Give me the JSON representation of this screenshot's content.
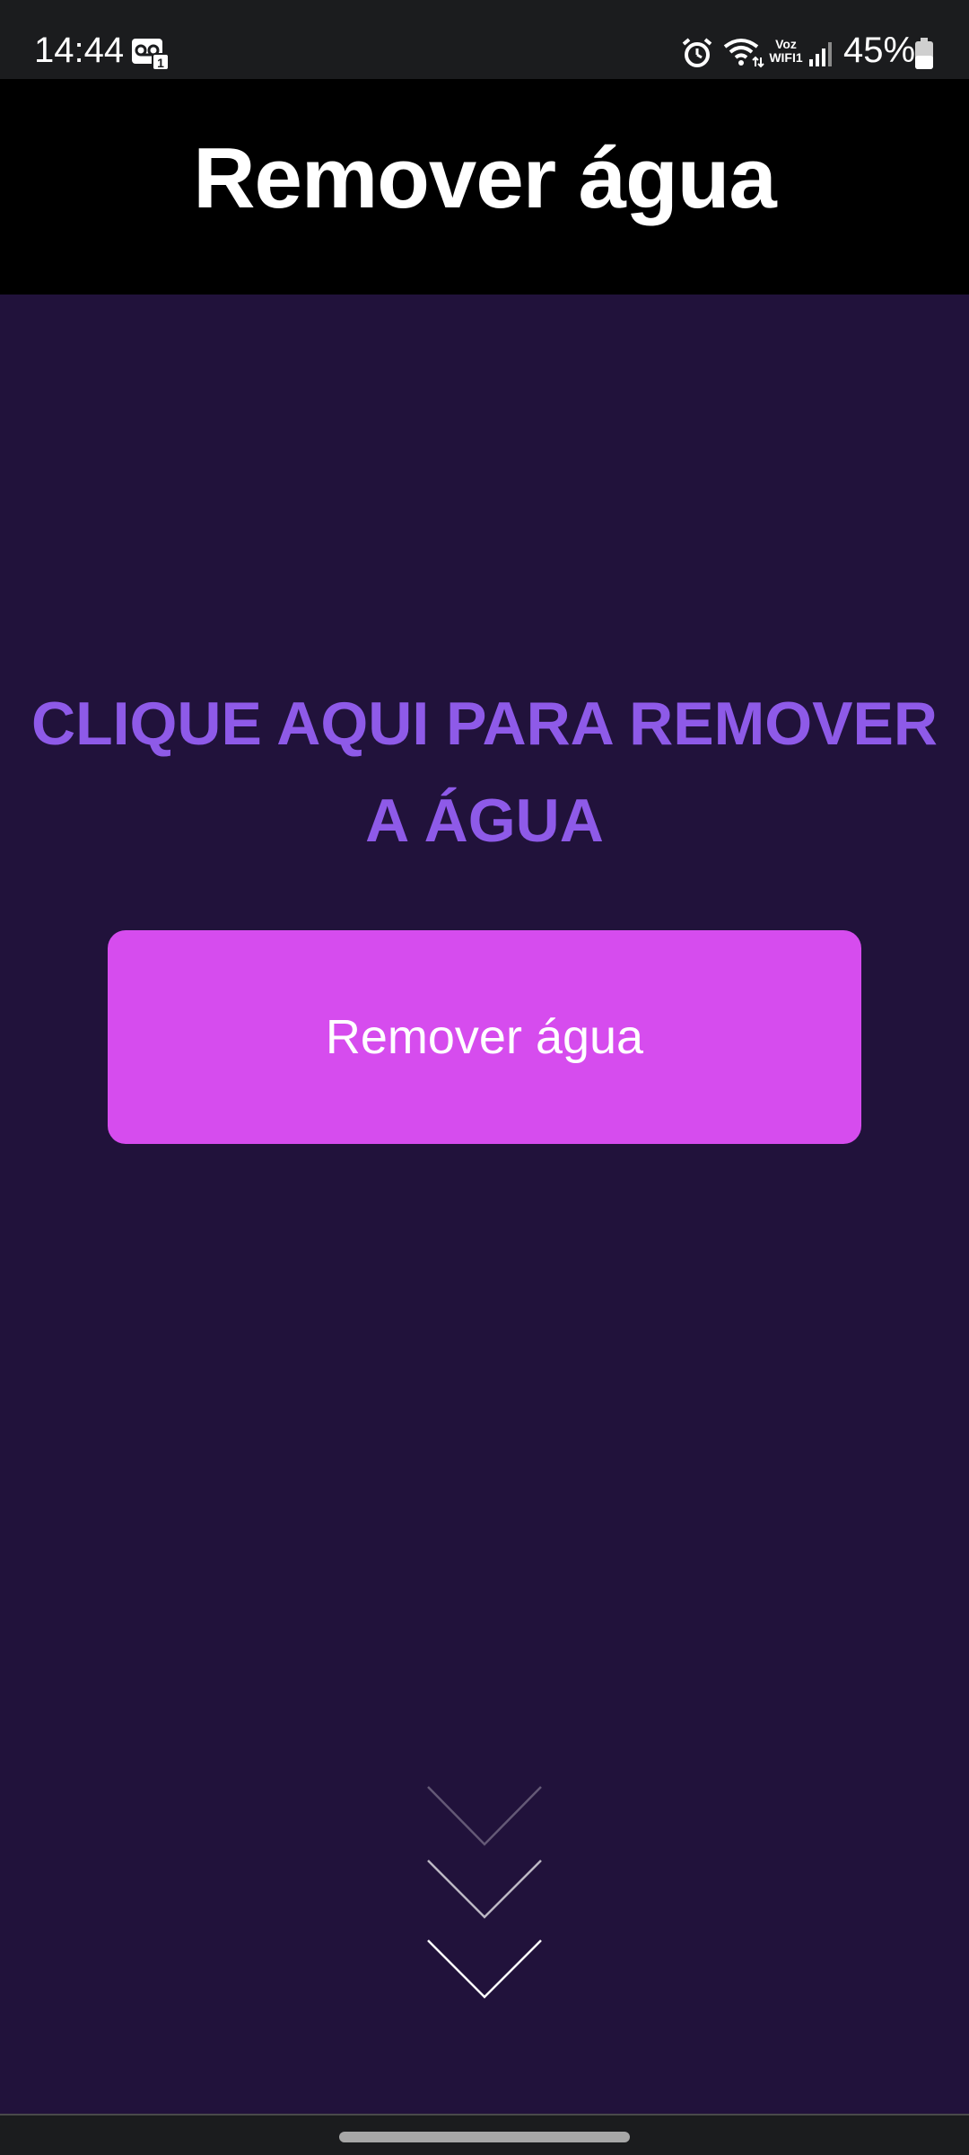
{
  "status_bar": {
    "time": "14:44",
    "voz_label": "Voz",
    "wifi_label": "WIFI1",
    "battery": "45%",
    "icons": [
      "voicemail-icon",
      "alarm-icon",
      "wifi-icon",
      "signal-icon",
      "battery-icon"
    ]
  },
  "header": {
    "title": "Remover água"
  },
  "main": {
    "prompt_line1": "CLIQUE AQUI PARA REMOVER",
    "prompt_line2": "A ÁGUA",
    "button_label": "Remover água"
  },
  "colors": {
    "background": "#21123b",
    "header": "#000000",
    "prompt_text": "#8e5ae8",
    "button": "#d64cee"
  }
}
